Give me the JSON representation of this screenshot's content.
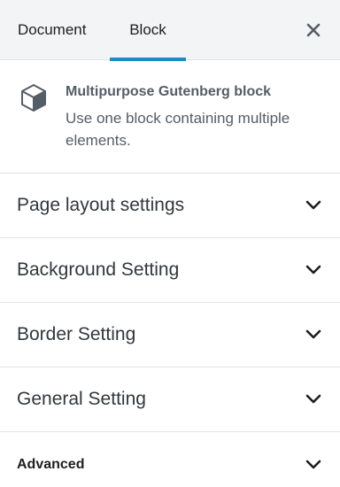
{
  "tabs": {
    "document_label": "Document",
    "block_label": "Block",
    "active": "Block"
  },
  "block_card": {
    "title": "Multipurpose Gutenberg block",
    "description": "Use one block containing multiple elements.",
    "icon": "cube-icon"
  },
  "panels": [
    {
      "label": "Page layout settings",
      "icon": "chevron-down-icon"
    },
    {
      "label": "Background Setting",
      "icon": "chevron-down-icon"
    },
    {
      "label": "Border Setting",
      "icon": "chevron-down-icon"
    },
    {
      "label": "General Setting",
      "icon": "chevron-down-icon"
    },
    {
      "label": "Advanced",
      "icon": "chevron-down-icon"
    }
  ],
  "colors": {
    "accent": "#1e8cbe",
    "header_bg": "#f3f4f5",
    "border": "#e2e4e7",
    "muted_text": "#555d66"
  }
}
